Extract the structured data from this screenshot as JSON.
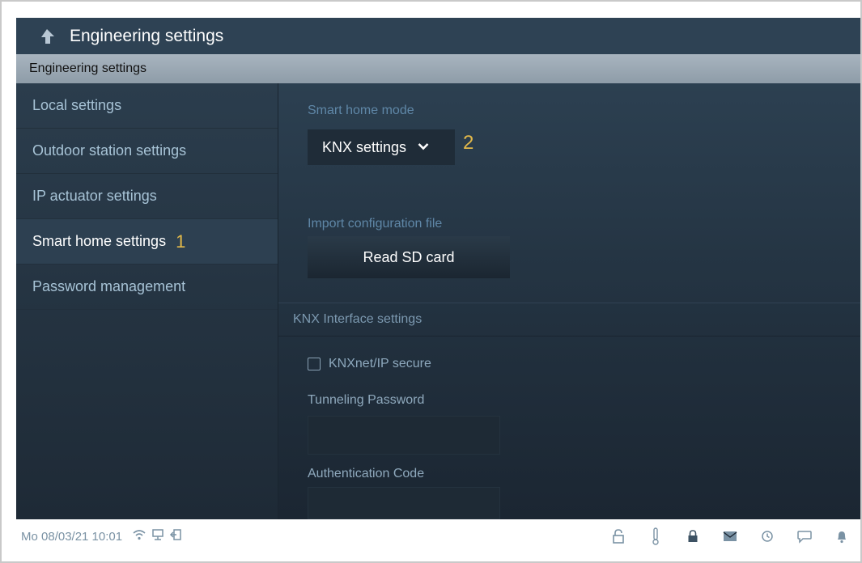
{
  "header": {
    "title": "Engineering settings",
    "back_icon": "back-arrow-icon"
  },
  "section": {
    "title": "Engineering settings"
  },
  "sidebar": {
    "items": [
      {
        "label": "Local settings",
        "active": false
      },
      {
        "label": "Outdoor station settings",
        "active": false
      },
      {
        "label": "IP actuator settings",
        "active": false
      },
      {
        "label": "Smart home settings",
        "active": true,
        "marker": "1"
      },
      {
        "label": "Password management",
        "active": false
      }
    ]
  },
  "main": {
    "smart_home_mode_label": "Smart home mode",
    "mode_select": {
      "value": "KNX settings",
      "marker": "2"
    },
    "import_label": "Import configuration file",
    "read_sd_button": "Read SD card",
    "knx_interface_header": "KNX Interface settings",
    "knxnet_checkbox_label": "KNXnet/IP secure",
    "tunneling_password_label": "Tunneling Password",
    "authentication_code_label": "Authentication Code"
  },
  "status_bar": {
    "datetime": "Mo 08/03/21  10:01",
    "left_icons": [
      "wifi-icon",
      "network-icon",
      "exit-icon"
    ],
    "right_icons": [
      "lock-icon",
      "thermometer-icon",
      "lock-small-icon",
      "mail-icon",
      "history-icon",
      "chat-icon",
      "bell-icon"
    ]
  },
  "colors": {
    "accent_marker": "#e3b94a",
    "text_muted": "#5f87a7"
  }
}
